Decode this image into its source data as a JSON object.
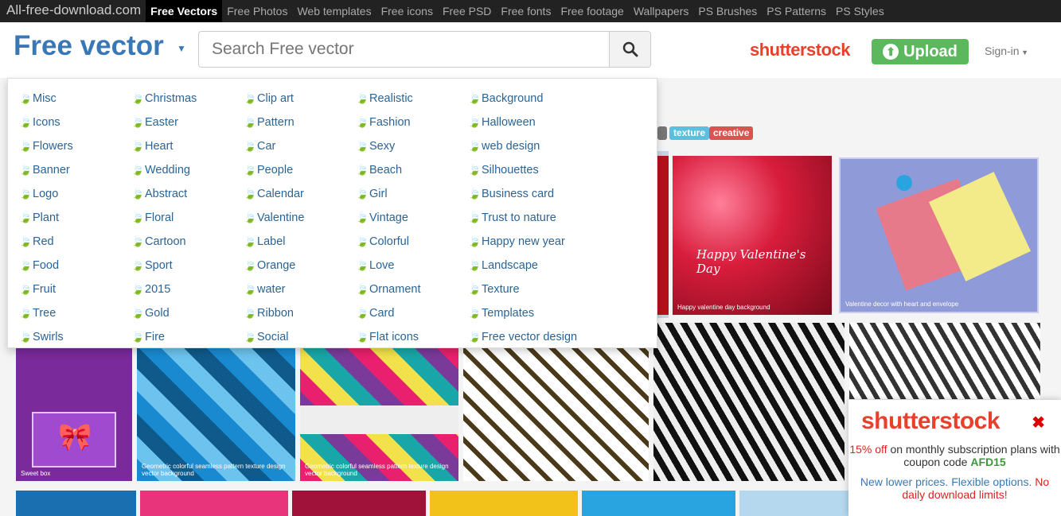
{
  "topnav": {
    "brand": "All-free-download.com",
    "items": [
      "Free Vectors",
      "Free Photos",
      "Web templates",
      "Free icons",
      "Free PSD",
      "Free fonts",
      "Free footage",
      "Wallpapers",
      "PS Brushes",
      "PS Patterns",
      "PS Styles"
    ]
  },
  "header": {
    "logo": "Free vector",
    "search_placeholder": "Search Free vector",
    "shutterstock": "shutterstock",
    "upload": "Upload",
    "signin": "Sign-in"
  },
  "background": {
    "tags": [
      "texture",
      "creative"
    ],
    "captions": [
      "Happy valentine day background",
      "Valentine decor with heart and envelope",
      "Sweet box",
      "Geometric colorful seamless pattern texture design vector background",
      "Geometric colorful seamless pattern texture design vector background"
    ]
  },
  "dropdown": {
    "columns": [
      [
        "Misc",
        "Icons",
        "Flowers",
        "Banner",
        "Logo",
        "Plant",
        "Red",
        "Food",
        "Fruit",
        "Tree",
        "Swirls"
      ],
      [
        "Christmas",
        "Easter",
        "Heart",
        "Wedding",
        "Abstract",
        "Floral",
        "Cartoon",
        "Sport",
        "2015",
        "Gold",
        "Fire"
      ],
      [
        "Clip art",
        "Pattern",
        "Car",
        "People",
        "Calendar",
        "Valentine",
        "Label",
        "Orange",
        "water",
        "Ribbon",
        "Social"
      ],
      [
        "Realistic",
        "Fashion",
        "Sexy",
        "Beach",
        "Girl",
        "Vintage",
        "Colorful",
        "Love",
        "Ornament",
        "Card",
        "Flat icons"
      ],
      [
        "Background",
        "Halloween",
        "web design",
        "Silhouettes",
        "Business card",
        "Trust to nature",
        "Happy new year",
        "Landscape",
        "Texture",
        "Templates",
        "Free vector design"
      ]
    ]
  },
  "promo": {
    "logo": "shutterstock",
    "offer_red": "15% off",
    "offer_rest": "on monthly subscription plans with coupon code",
    "code": "AFD15",
    "line2_blue": "New lower prices. Flexible options.",
    "line2_red": "No daily download limits!"
  }
}
